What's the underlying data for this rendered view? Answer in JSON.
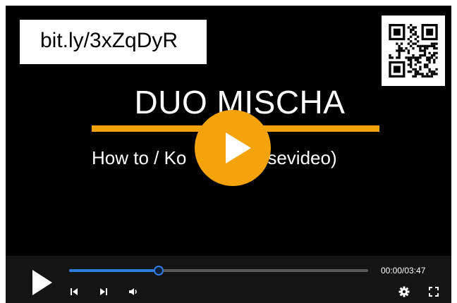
{
  "video": {
    "short_url": "bit.ly/3xZqDyR",
    "title": "DUO MISCHA",
    "subtitle": "How to / Ko",
    "subtitle_tail": "ansevideo)"
  },
  "controls": {
    "current_time": "00:00",
    "separator": "/",
    "duration": "03:47",
    "progress_fraction": 0.3
  },
  "icons": {
    "big_play": "play-icon",
    "play": "play-icon",
    "prev": "skip-previous-icon",
    "next": "skip-next-icon",
    "volume": "volume-icon",
    "settings": "gear-icon",
    "fullscreen": "fullscreen-icon",
    "qr": "qr-code"
  },
  "colors": {
    "accent_orange": "#f5a30a",
    "progress_blue": "#2f7de1",
    "background": "#000000",
    "controls_bg": "#141414"
  }
}
